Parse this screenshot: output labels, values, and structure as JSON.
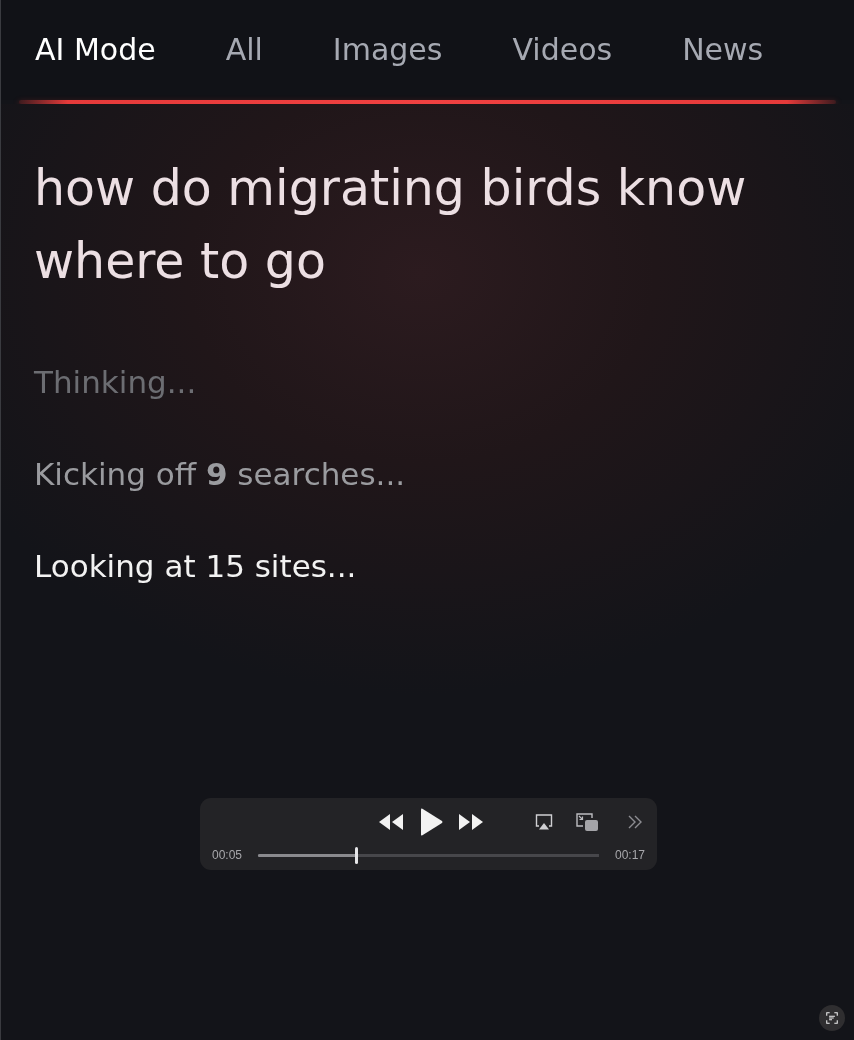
{
  "tabs": [
    {
      "label": "AI Mode",
      "selected": true
    },
    {
      "label": "All",
      "selected": false
    },
    {
      "label": "Images",
      "selected": false
    },
    {
      "label": "Videos",
      "selected": false
    },
    {
      "label": "News",
      "selected": false
    }
  ],
  "query": "how do migrating birds know where to go",
  "progress_steps": [
    {
      "text": "Thinking...",
      "color": "#6c6d72"
    },
    {
      "text": "Kicking off **9** searches...",
      "color": "#9a9b9f"
    },
    {
      "text": "Looking at 15 sites...",
      "color": "#f2f2f2"
    }
  ],
  "video_player": {
    "playing": false,
    "elapsed": "00:05",
    "duration": "00:17",
    "level": 0.29
  }
}
